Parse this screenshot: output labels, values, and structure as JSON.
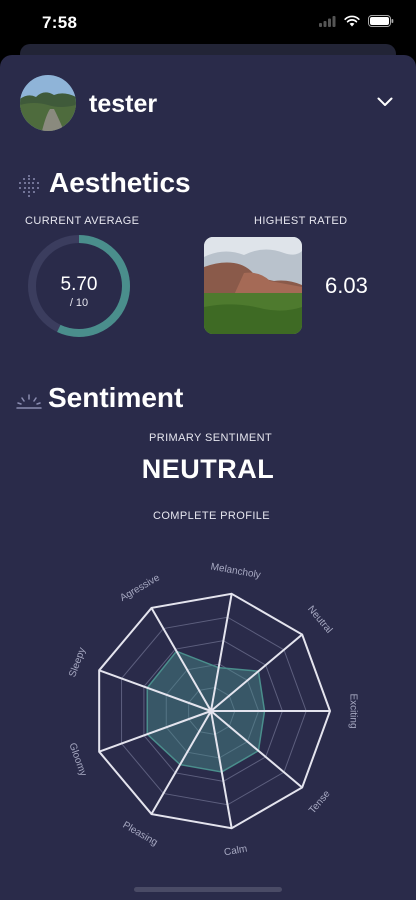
{
  "status_bar": {
    "time": "7:58"
  },
  "profile": {
    "username": "tester"
  },
  "aesthetics": {
    "title": "Aesthetics",
    "current_average_label": "CURRENT AVERAGE",
    "current_average": "5.70",
    "scale": "/ 10",
    "current_average_fraction": 0.57,
    "highest_rated_label": "HIGHEST RATED",
    "highest_rated_value": "6.03"
  },
  "sentiment": {
    "title": "Sentiment",
    "primary_label": "PRIMARY SENTIMENT",
    "primary_value": "NEUTRAL",
    "profile_label": "COMPLETE PROFILE"
  },
  "chart_data": {
    "type": "radar",
    "categories": [
      "Melancholy",
      "Neutral",
      "Exciting",
      "Tense",
      "Calm",
      "Pleasing",
      "Gloomy",
      "Sleepy",
      "Agressive"
    ],
    "values": [
      0.37,
      0.52,
      0.45,
      0.52,
      0.52,
      0.52,
      0.57,
      0.57,
      0.58
    ],
    "rmax": 1,
    "rings": 5
  },
  "colors": {
    "accent": "#4a8e8c",
    "background": "#2a2b4a"
  }
}
